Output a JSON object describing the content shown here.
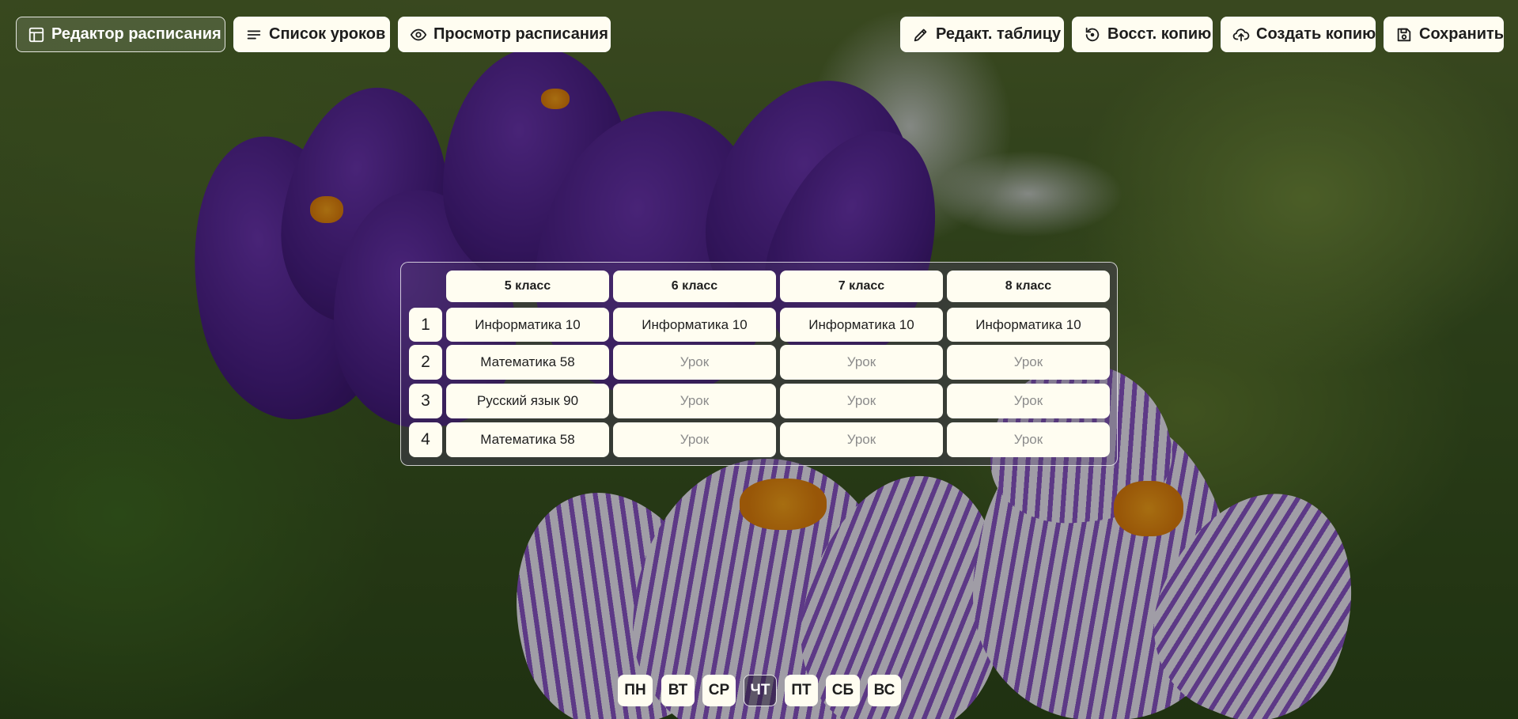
{
  "nav": {
    "editor": "Редактор расписания",
    "lessons": "Список уроков",
    "view": "Просмотр расписания"
  },
  "actions": {
    "edit_table": "Редакт. таблицу",
    "restore_copy": "Восст. копию",
    "create_copy": "Создать копию",
    "save": "Сохранить"
  },
  "schedule": {
    "classes": [
      "5 класс",
      "6 класс",
      "7 класс",
      "8 класс"
    ],
    "lesson_numbers": [
      "1",
      "2",
      "3",
      "4"
    ],
    "rows": [
      [
        "Информатика 10",
        "Информатика 10",
        "Информатика 10",
        "Информатика 10"
      ],
      [
        "Математика 58",
        "Урок",
        "Урок",
        "Урок"
      ],
      [
        "Русский язык 90",
        "Урок",
        "Урок",
        "Урок"
      ],
      [
        "Математика 58",
        "Урок",
        "Урок",
        "Урок"
      ]
    ],
    "placeholder": "Урок"
  },
  "days": [
    "ПН",
    "ВТ",
    "СР",
    "ЧТ",
    "ПТ",
    "СБ",
    "ВС"
  ],
  "active_day": "ЧТ",
  "icons": {
    "editor": "layout-table-icon",
    "lessons": "list-icon",
    "view": "eye-icon",
    "edit_table": "pencil-icon",
    "restore_copy": "restore-icon",
    "create_copy": "cloud-upload-icon",
    "save": "floppy-disk-icon"
  },
  "colors": {
    "button_bg": "#fffdf1",
    "text": "#1d1d1d",
    "placeholder_text": "#8c8c8c",
    "active_border": "#ffffff"
  }
}
